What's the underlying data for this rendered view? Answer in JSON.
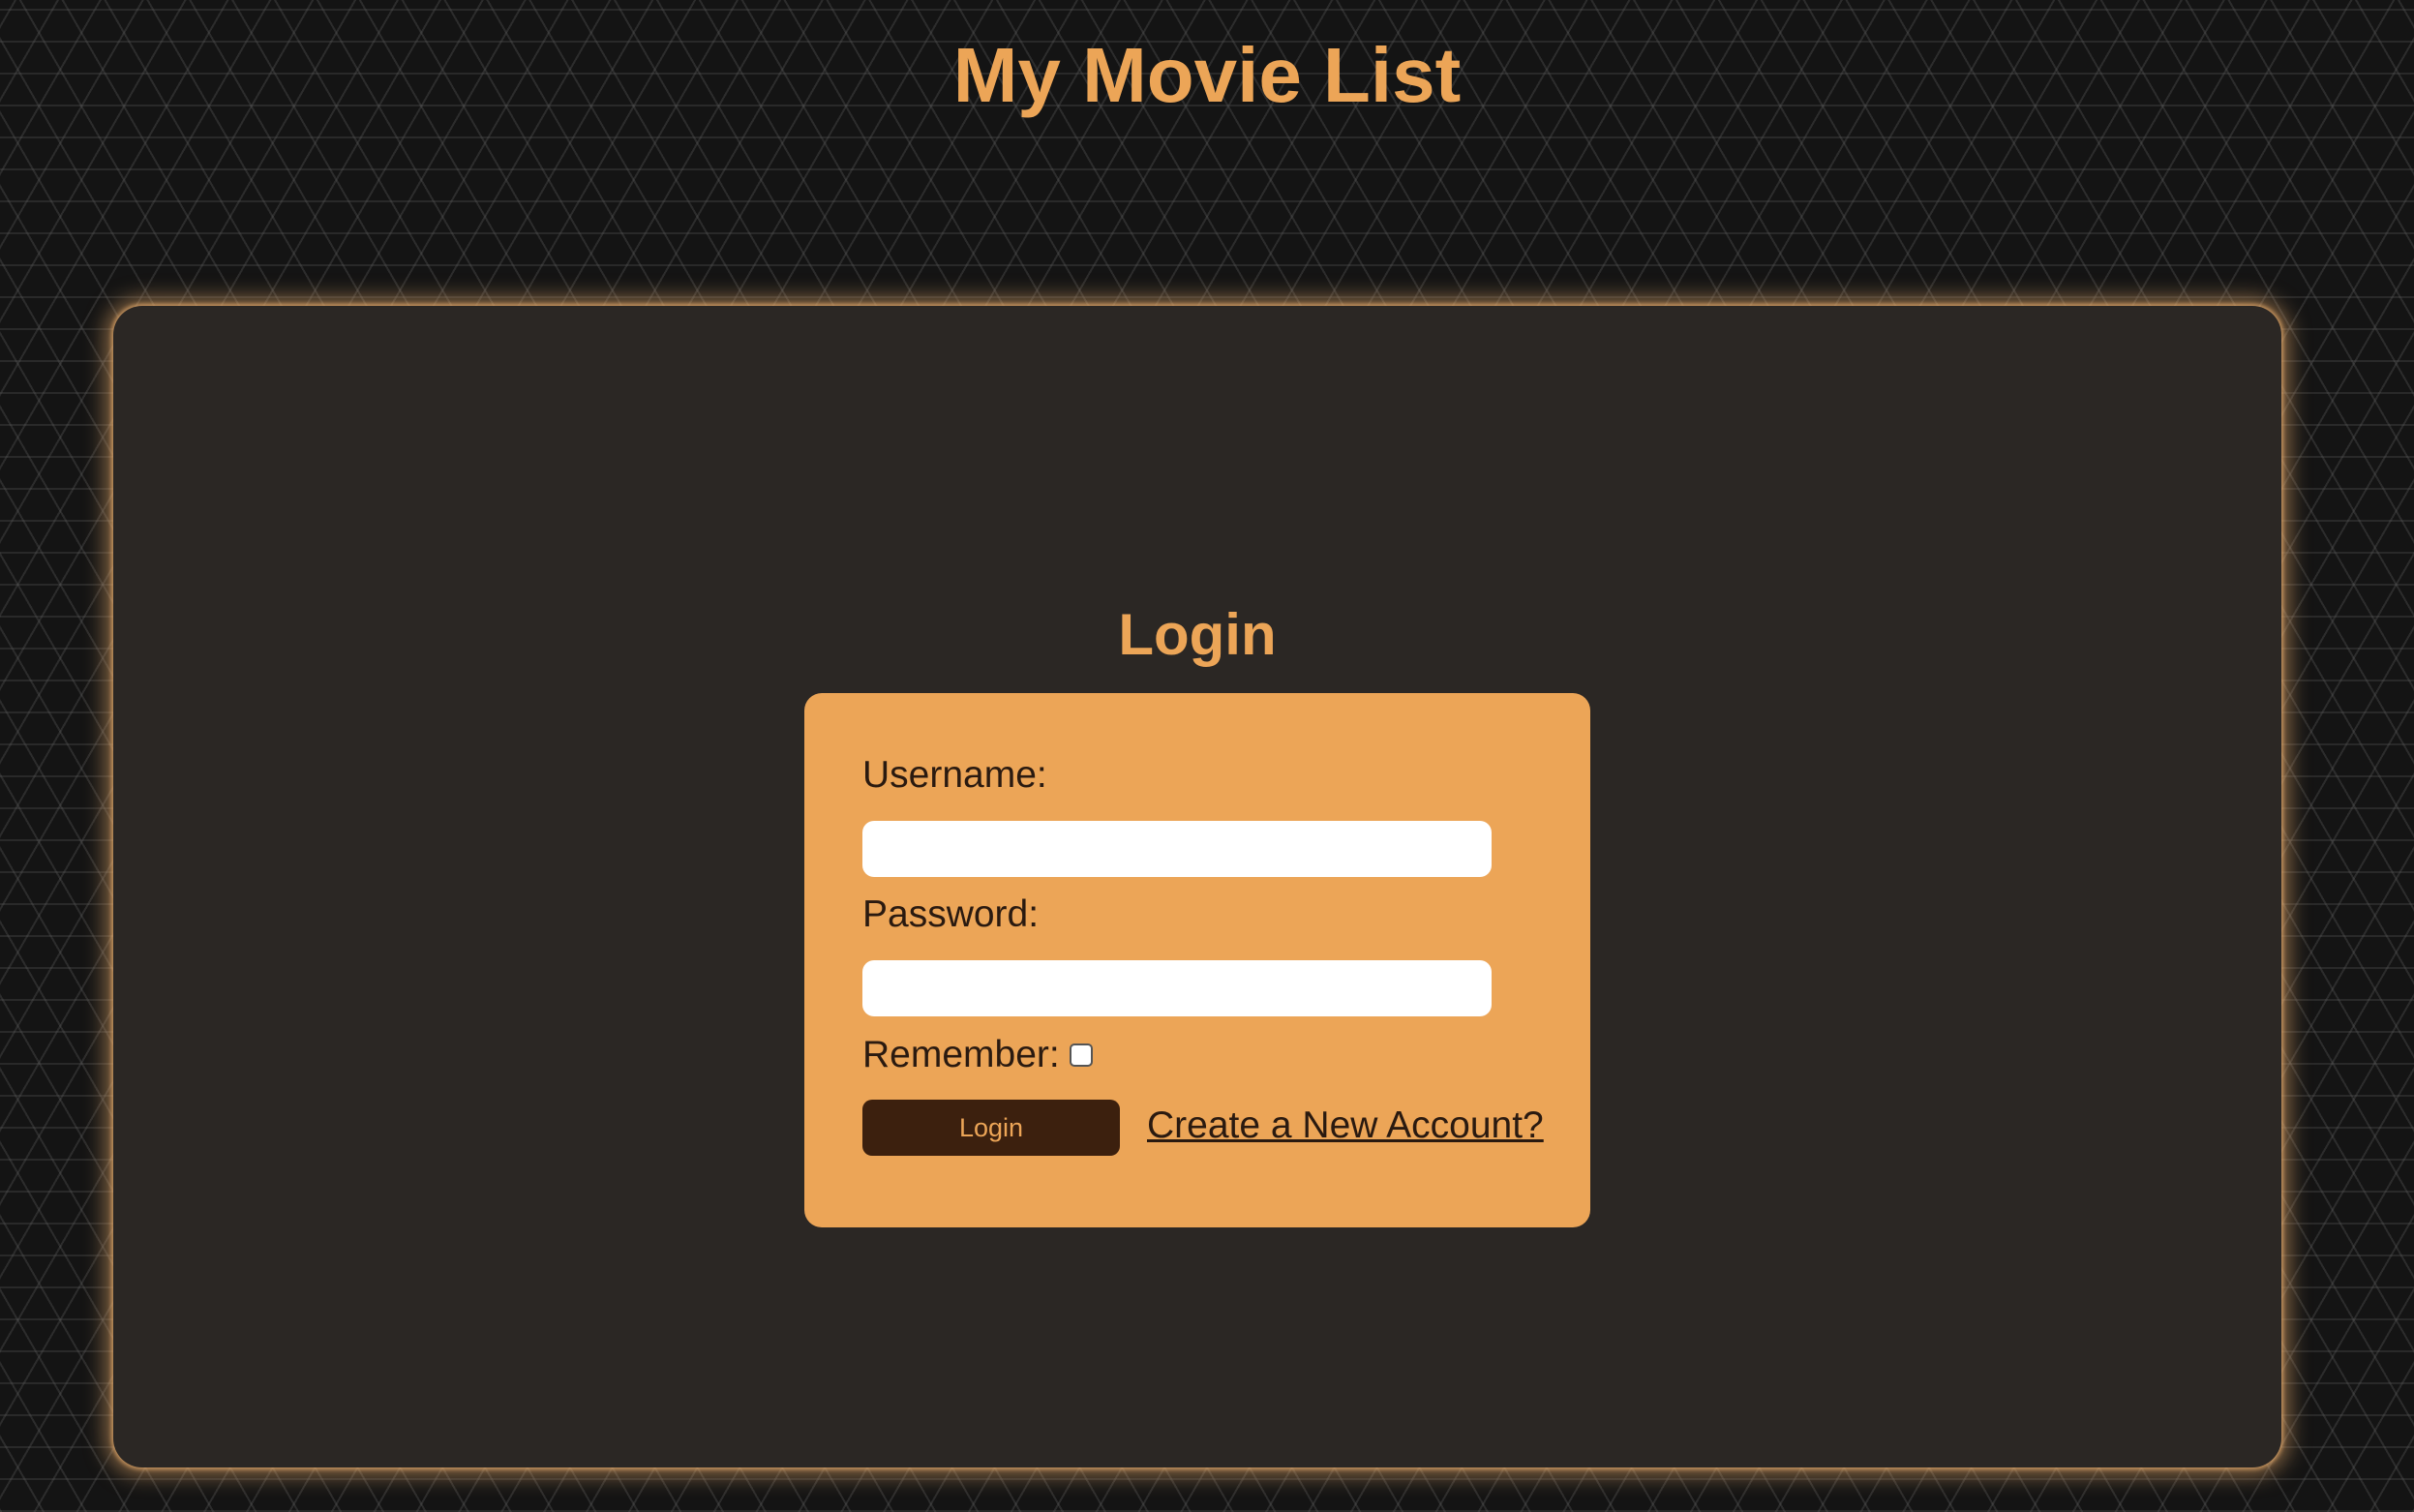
{
  "header": {
    "site_title": "My Movie List"
  },
  "login": {
    "heading": "Login",
    "username_label": "Username:",
    "username_value": "",
    "password_label": "Password:",
    "password_value": "",
    "remember_label": "Remember:",
    "remember_checked": false,
    "submit_label": "Login",
    "create_account_link": "Create a New Account?"
  },
  "colors": {
    "accent": "#eca557",
    "panel_background": "#2b2724",
    "page_background": "#141414",
    "button_background": "#3c200e",
    "label_text": "#2a1a10"
  }
}
